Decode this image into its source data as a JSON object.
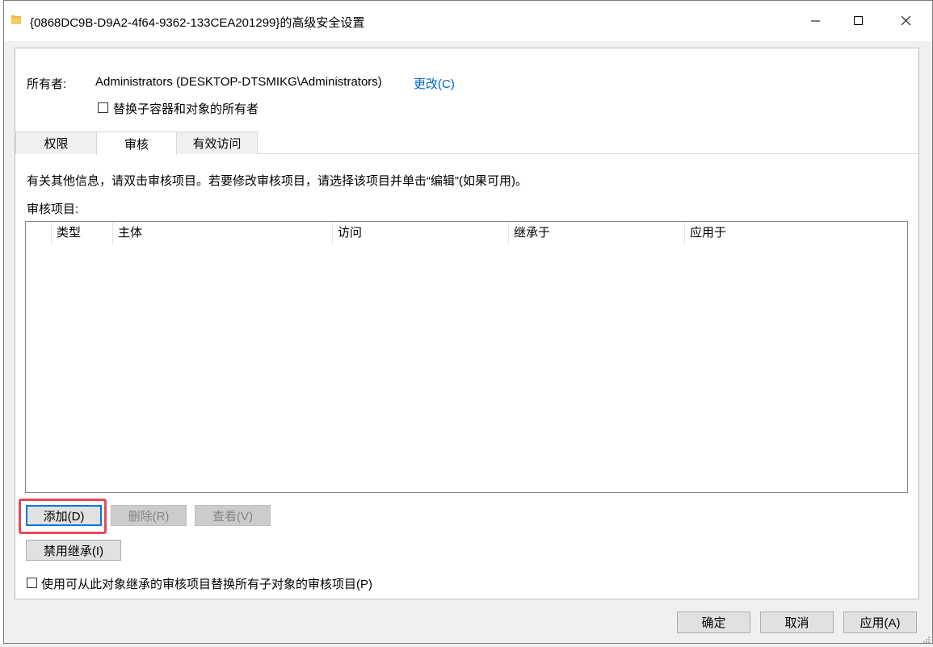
{
  "window": {
    "title": "{0868DC9B-D9A2-4f64-9362-133CEA201299}的高级安全设置"
  },
  "owner": {
    "label": "所有者:",
    "value": "Administrators (DESKTOP-DTSMIKG\\Administrators)",
    "change_link": "更改(C)",
    "replace_checkbox_label": "替换子容器和对象的所有者",
    "replace_checked": false
  },
  "tabs": [
    {
      "label": "权限",
      "active": false
    },
    {
      "label": "审核",
      "active": true
    },
    {
      "label": "有效访问",
      "active": false
    }
  ],
  "audit": {
    "info": "有关其他信息，请双击审核项目。若要修改审核项目，请选择该项目并单击“编辑”(如果可用)。",
    "entries_label": "审核项目:",
    "columns": [
      "类型",
      "主体",
      "访问",
      "继承于",
      "应用于"
    ],
    "rows": []
  },
  "buttons": {
    "add": "添加(D)",
    "remove": "删除(R)",
    "view": "查看(V)",
    "disable_inheritance": "禁用继承(I)"
  },
  "replace_child_checkbox": {
    "label": "使用可从此对象继承的审核项目替换所有子对象的审核项目(P)",
    "checked": false
  },
  "footer": {
    "ok": "确定",
    "cancel": "取消",
    "apply": "应用(A)"
  },
  "colors": {
    "accent": "#0078d7",
    "link": "#0066cc",
    "highlight": "#e8495a"
  }
}
